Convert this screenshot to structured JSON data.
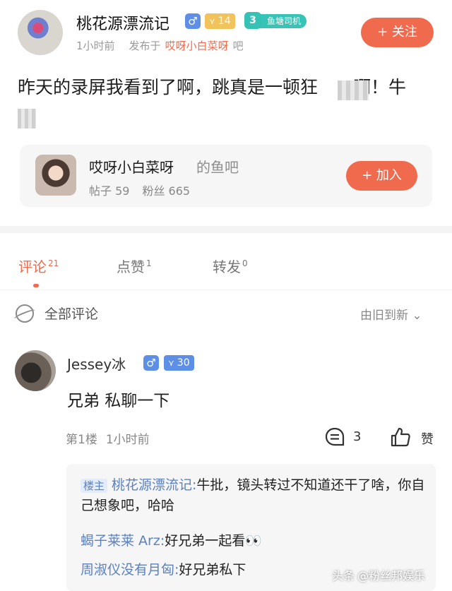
{
  "post": {
    "author": "桃花源漂流记",
    "gender_symbol": "♂",
    "level": "14",
    "badge_number": "3",
    "badge_label": "鱼塘司机",
    "time": "1小时前",
    "posted_in_prefix": "发布于",
    "forum": "哎呀小白菜呀",
    "forum_suffix": "吧",
    "follow_label": "+ 关注",
    "text": "昨天的录屏我看到了啊，跳真是一顿狂　　啊！牛"
  },
  "card": {
    "name": "哎呀小白菜呀",
    "suffix": "的鱼吧",
    "posts_label": "帖子 59",
    "fans_label": "粉丝 665",
    "join_label": "+ 加入"
  },
  "tabs": [
    {
      "label": "评论",
      "count": "21"
    },
    {
      "label": "点赞",
      "count": "1"
    },
    {
      "label": "转发",
      "count": "0"
    }
  ],
  "comments_header": {
    "title": "全部评论",
    "sort": "由旧到新 ⌄"
  },
  "comment": {
    "name": "Jessey冰",
    "gender_symbol": "♂",
    "level": "30",
    "text": "兄弟 私聊一下",
    "floor": "第1楼",
    "time": "1小时前",
    "reply_count": "3",
    "like_label": "赞"
  },
  "replies": [
    {
      "tag": "楼主",
      "user": "桃花源漂流记:",
      "text": "牛批，镜头转过不知道还干了啥，你自己想象吧，哈哈"
    },
    {
      "tag": "",
      "user": "蝎子莱莱 Arz:",
      "text": "好兄弟一起看👀"
    },
    {
      "tag": "",
      "user": "周淑仪没有月匈:",
      "text": "好兄弟私下"
    }
  ],
  "watermark": {
    "source": "头条",
    "account": "@粉丝邦娱乐"
  }
}
